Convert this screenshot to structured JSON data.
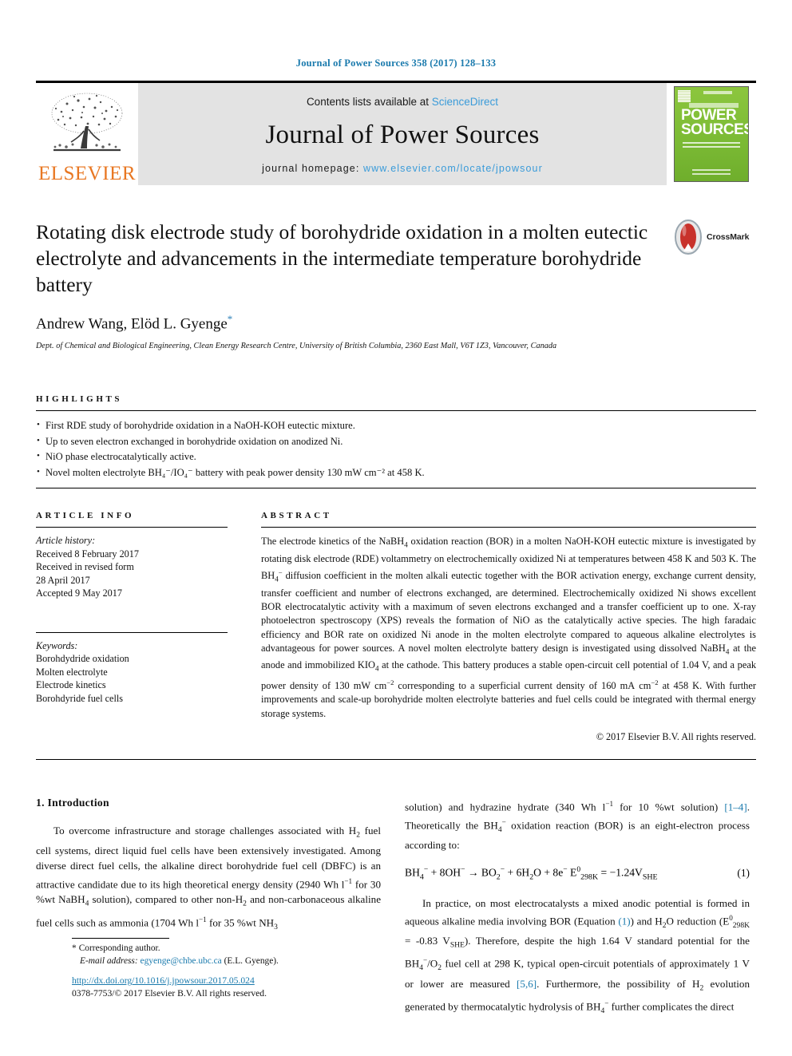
{
  "running_head": "Journal of Power Sources 358 (2017) 128–133",
  "masthead": {
    "publisher_logo_text": "ELSEVIER",
    "contents_prefix": "Contents lists available at ",
    "contents_link": "ScienceDirect",
    "journal_name": "Journal of Power Sources",
    "homepage_prefix": "journal homepage: ",
    "homepage_url": "www.elsevier.com/locate/jpowsour",
    "cover": {
      "line1": "POWER",
      "line2": "SOURCES",
      "accent_color": "#7cbb35"
    }
  },
  "article": {
    "title": "Rotating disk electrode study of borohydride oxidation in a molten eutectic electrolyte and advancements in the intermediate temperature borohydride battery",
    "crossmark_label": "CrossMark",
    "authors": "Andrew Wang, Elöd L. Gyenge",
    "corresponding_marker": "*",
    "affiliation": "Dept. of Chemical and Biological Engineering, Clean Energy Research Centre, University of British Columbia, 2360 East Mall, V6T 1Z3, Vancouver, Canada"
  },
  "highlights": {
    "label": "HIGHLIGHTS",
    "items": [
      "First RDE study of borohydride oxidation in a NaOH-KOH eutectic mixture.",
      "Up to seven electron exchanged in borohydride oxidation on anodized Ni.",
      "NiO phase electrocatalytically active.",
      "Novel molten electrolyte BH₄⁻/IO₄⁻ battery with peak power density 130 mW cm⁻² at 458 K."
    ]
  },
  "article_info": {
    "label": "ARTICLE INFO",
    "history_heading": "Article history:",
    "history_lines": [
      "Received 8 February 2017",
      "Received in revised form",
      "28 April 2017",
      "Accepted 9 May 2017"
    ],
    "keywords_heading": "Keywords:",
    "keywords": [
      "Borohdydride oxidation",
      "Molten electrolyte",
      "Electrode kinetics",
      "Borohdyride fuel cells"
    ]
  },
  "abstract": {
    "label": "ABSTRACT",
    "text": "The electrode kinetics of the NaBH4 oxidation reaction (BOR) in a molten NaOH-KOH eutectic mixture is investigated by rotating disk electrode (RDE) voltammetry on electrochemically oxidized Ni at temperatures between 458 K and 503 K. The BH4- diffusion coefficient in the molten alkali eutectic together with the BOR activation energy, exchange current density, transfer coefficient and number of electrons exchanged, are determined. Electrochemically oxidized Ni shows excellent BOR electrocatalytic activity with a maximum of seven electrons exchanged and a transfer coefficient up to one. X-ray photoelectron spectroscopy (XPS) reveals the formation of NiO as the catalytically active species. The high faradaic efficiency and BOR rate on oxidized Ni anode in the molten electrolyte compared to aqueous alkaline electrolytes is advantageous for power sources. A novel molten electrolyte battery design is investigated using dissolved NaBH4 at the anode and immobilized KIO4 at the cathode. This battery produces a stable open-circuit cell potential of 1.04 V, and a peak power density of 130 mW cm-2 corresponding to a superficial current density of 160 mA cm-2 at 458 K. With further improvements and scale-up borohydride molten electrolyte batteries and fuel cells could be integrated with thermal energy storage systems.",
    "copyright": "© 2017 Elsevier B.V. All rights reserved."
  },
  "introduction": {
    "heading": "1. Introduction",
    "para1_part1": "To overcome infrastructure and storage challenges associated with H",
    "para1_part2": " fuel cell systems, direct liquid fuel cells have been extensively investigated. Among diverse direct fuel cells, the alkaline direct borohydride fuel cell (DBFC) is an attractive candidate due to its high theoretical energy density (2940 Wh l",
    "para1_part3": " for 30 %wt NaBH",
    "para1_part4": " solution), compared to other non-H",
    "para1_part5": " and non-carbonaceous alkaline fuel cells such as ammonia (1704 Wh l",
    "para1_part6": " for 35 %wt NH",
    "para1_cont": "solution) and hydrazine hydrate (340 Wh l",
    "para1_cont2": " for 10 %wt solution) ",
    "ref_1_4": "[1–4]",
    "para1_cont3": ". Theoretically the BH",
    "para1_cont4": " oxidation reaction (BOR) is an eight-electron process according to:",
    "equation": "BH4⁻ + 8OH⁻ → BO2⁻ + 6H2O + 8e⁻ E⁰298K = −1.24VSHE",
    "equation_number": "(1)",
    "para2_a": "In practice, on most electrocatalysts a mixed anodic potential is formed in aqueous alkaline media involving BOR (Equation ",
    "ref_eq1": "(1)",
    "para2_b": ") and H2O reduction (E⁰298K = -0.83 VSHE). Therefore, despite the high 1.64 V standard potential for the BH4⁻/O2 fuel cell at 298 K, typical open-circuit potentials of approximately 1 V or lower are measured ",
    "ref_5_6": "[5,6]",
    "para2_c": ". Furthermore, the possibility of H2 evolution generated by thermocatalytic hydrolysis of BH4⁻ further complicates the direct"
  },
  "footnote": {
    "star": "*",
    "corresponding": "Corresponding author.",
    "email_label": "E-mail address:",
    "email": "egyenge@chbe.ubc.ca",
    "email_suffix": "(E.L. Gyenge)."
  },
  "footer": {
    "doi": "http://dx.doi.org/10.1016/j.jpowsour.2017.05.024",
    "issn_line": "0378-7753/© 2017 Elsevier B.V. All rights reserved."
  }
}
